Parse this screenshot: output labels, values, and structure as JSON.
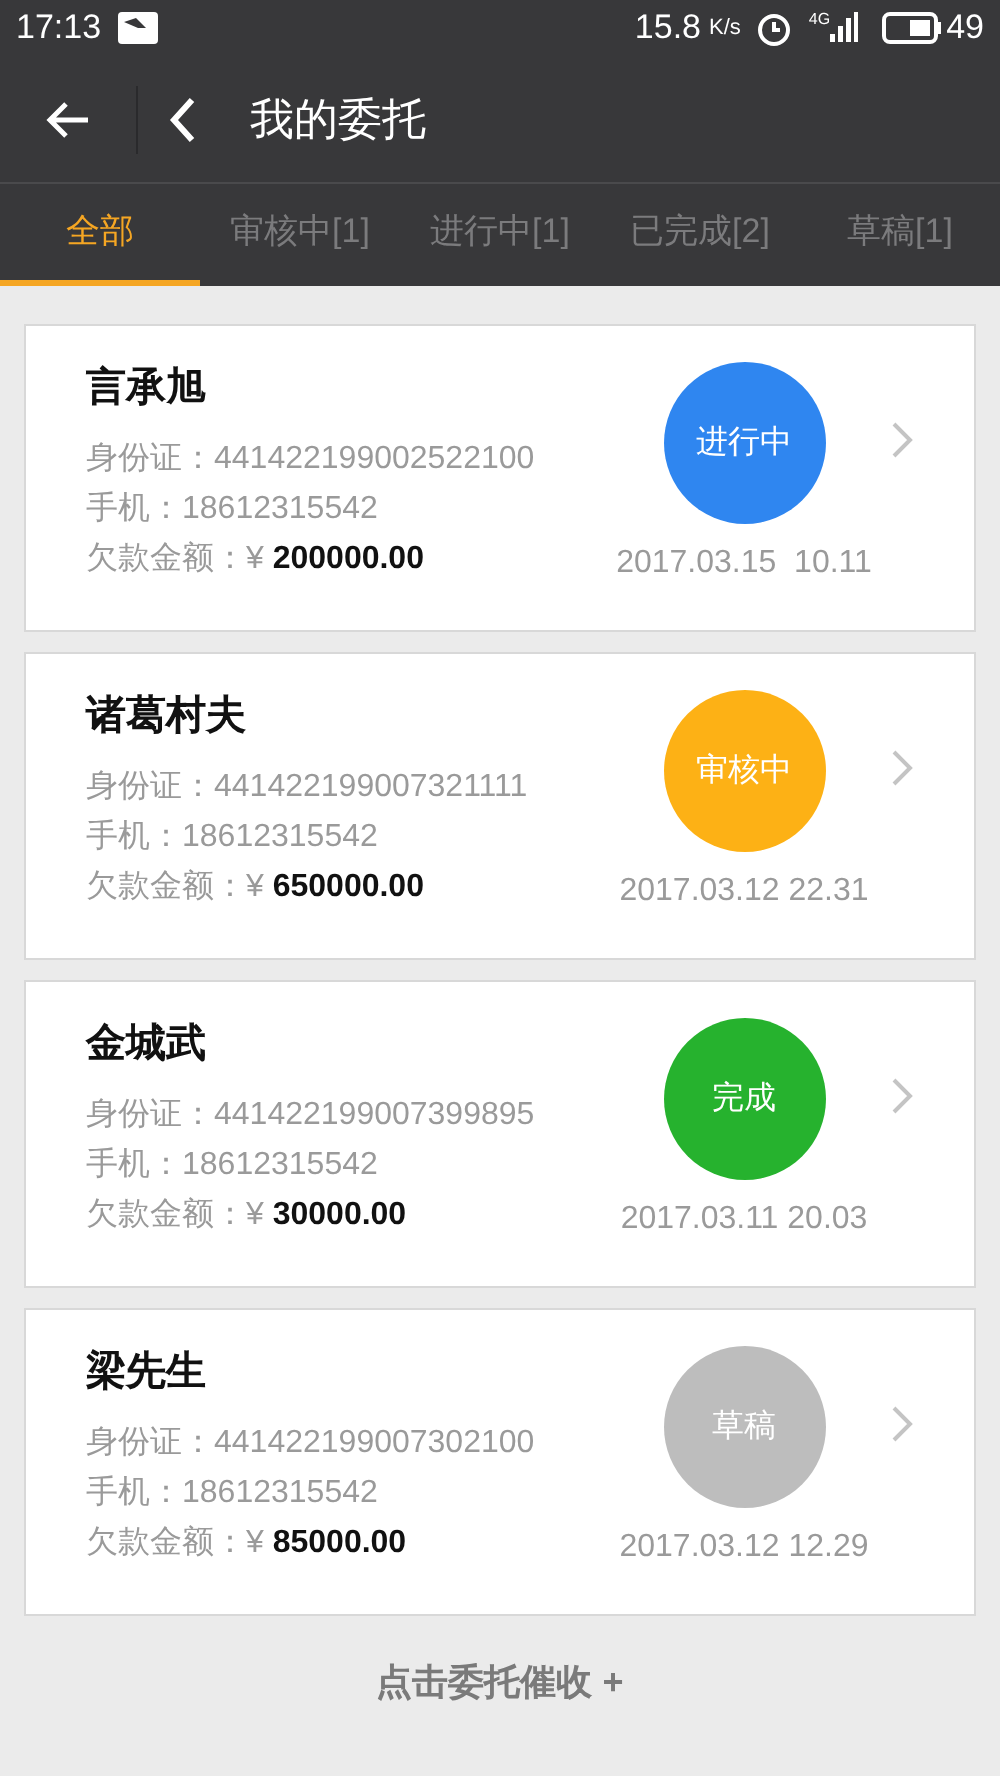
{
  "status_bar": {
    "time": "17:13",
    "speed": "15.8",
    "speed_unit": "K/s",
    "network": "4G",
    "battery": "49"
  },
  "header": {
    "title": "我的委托"
  },
  "tabs": [
    {
      "label": "全部",
      "selected": true
    },
    {
      "label": "审核中[1]",
      "selected": false
    },
    {
      "label": "进行中[1]",
      "selected": false
    },
    {
      "label": "已完成[2]",
      "selected": false
    },
    {
      "label": "草稿[1]",
      "selected": false
    }
  ],
  "cards": [
    {
      "name": "言承旭",
      "id": "身份证：441422199002522100",
      "phone": "手机：18612315542",
      "amount": "欠款金额：¥ **200000.00**",
      "status": "进行中",
      "color": "#2f86f0",
      "time": "2017.03.15  10.11"
    },
    {
      "name": "诸葛村夫",
      "id": "身份证：441422199007321111",
      "phone": "手机：18612315542",
      "amount": "欠款金额：¥ **650000.00**",
      "status": "审核中",
      "color": "#fdb115",
      "time": "2017.03.12 22.31"
    },
    {
      "name": "金城武",
      "id": "身份证：441422199007399895",
      "phone": "手机：18612315542",
      "amount": "欠款金额：¥ **30000.00**",
      "status": "完成",
      "color": "#26b22e",
      "time": "2017.03.11 20.03"
    },
    {
      "name": "梁先生",
      "id": "身份证：441422199007302100",
      "phone": "手机：18612315542",
      "amount": "欠款金额：¥ **85000.00**",
      "status": "草稿",
      "color": "#bdbdbd",
      "time": "2017.03.12 12.29"
    }
  ],
  "footer": {
    "link": "点击委托催收 +"
  }
}
